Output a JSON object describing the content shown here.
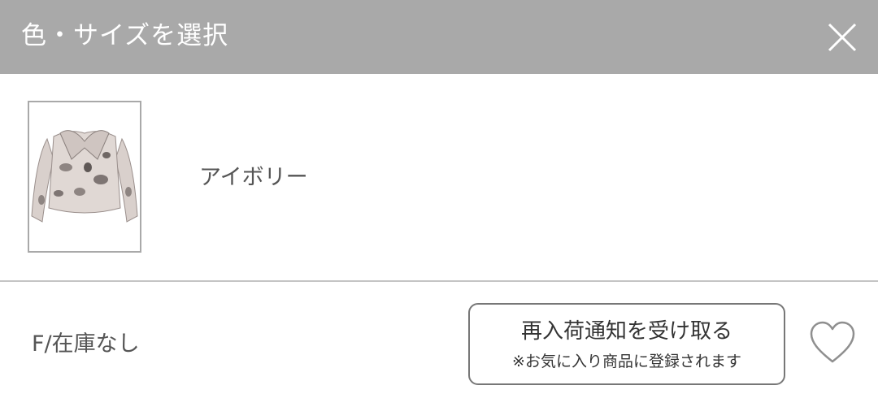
{
  "header": {
    "title": "色・サイズを選択",
    "close_icon": "close-icon"
  },
  "product": {
    "thumbnail_alt_icon": "fur-jacket-image",
    "color_name": "アイボリー"
  },
  "size_option": {
    "label": "F/在庫なし",
    "restock_button": {
      "main": "再入荷通知を受け取る",
      "sub": "※お気に入り商品に登録されます"
    },
    "favorite_icon": "heart-outline-icon"
  },
  "colors": {
    "header_bg": "#a9a9a9",
    "text": "#333333",
    "border": "#777777"
  }
}
